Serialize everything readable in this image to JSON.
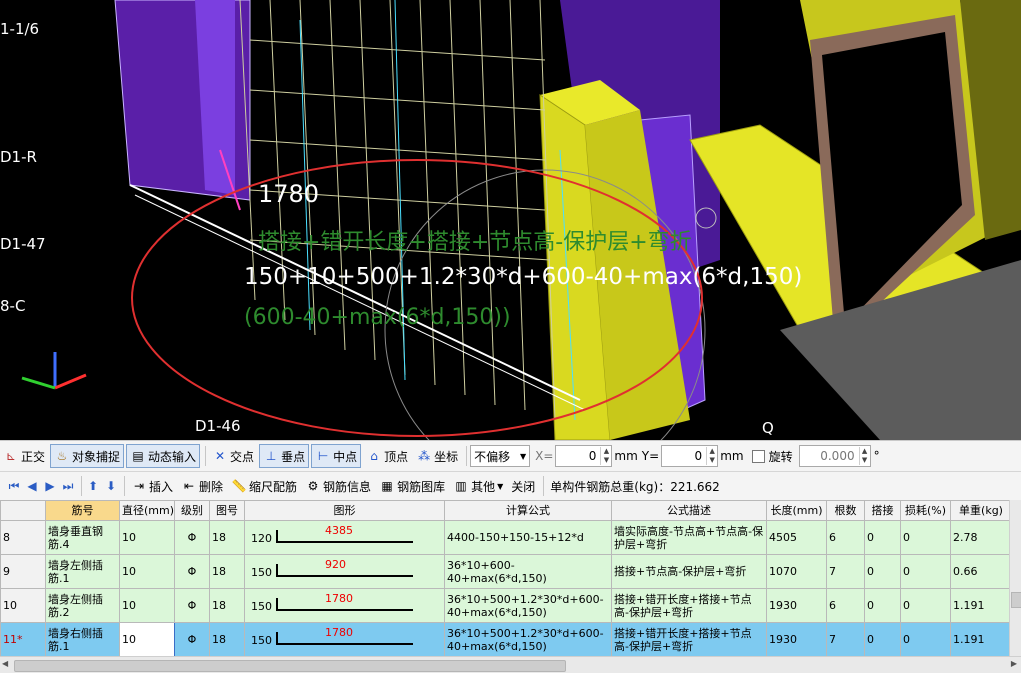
{
  "viewport": {
    "axis_labels": [
      "1-1/6",
      "D1-R",
      "D1-47",
      "8-C",
      "D1-46",
      "Q"
    ],
    "overlay_length": "1780",
    "overlay_formula_desc": "搭接+错开长度+搭接+节点高-保护层+弯折",
    "overlay_formula_line1": "150+10+500+1.2*30*d+600-40+max(6*d,150)",
    "overlay_formula_line2": "(600-40+max(6*d,150))",
    "highlight_color": "#e03030",
    "formula_color": "#2e8b2e"
  },
  "toolbar1": {
    "ortho": "正交",
    "snap": "对象捕捉",
    "dynamic_input": "动态输入",
    "intersection": "交点",
    "perpendicular": "垂点",
    "midpoint": "中点",
    "vertex": "顶点",
    "coordinate": "坐标",
    "offset_select": "不偏移",
    "x_label": "X=",
    "x_value": "0",
    "x_unit": "mm",
    "y_label": "Y=",
    "y_value": "0",
    "y_unit": "mm",
    "rotate_label": "旋转",
    "rotate_value": "0.000",
    "degree": "°"
  },
  "toolbar2": {
    "insert": "插入",
    "delete": "删除",
    "scale_rebar": "缩尺配筋",
    "rebar_info": "钢筋信息",
    "rebar_library": "钢筋图库",
    "other": "其他",
    "close": "关闭",
    "total_weight": "单构件钢筋总重(kg)：221.662"
  },
  "table": {
    "columns": [
      "筋号",
      "直径(mm)",
      "级别",
      "图号",
      "图形",
      "计算公式",
      "公式描述",
      "长度(mm)",
      "根数",
      "搭接",
      "损耗(%)",
      "单重(kg)"
    ],
    "rows": [
      {
        "row_no": "8",
        "name": "墙身垂直钢筋.4",
        "diameter": "10",
        "grade": "Φ",
        "fig_no": "18",
        "shape_lead": "120",
        "shape_len": "4385",
        "formula": "4400-150+150-15+12*d",
        "desc": "墙实际高度-节点高+节点高-保护层+弯折",
        "length": "4505",
        "count": "6",
        "lap": "0",
        "loss": "0",
        "unit_weight": "2.78"
      },
      {
        "row_no": "9",
        "name": "墙身左侧插筋.1",
        "diameter": "10",
        "grade": "Φ",
        "fig_no": "18",
        "shape_lead": "150",
        "shape_len": "920",
        "formula": "36*10+600-40+max(6*d,150)",
        "desc": "搭接+节点高-保护层+弯折",
        "length": "1070",
        "count": "7",
        "lap": "0",
        "loss": "0",
        "unit_weight": "0.66"
      },
      {
        "row_no": "10",
        "name": "墙身左侧插筋.2",
        "diameter": "10",
        "grade": "Φ",
        "fig_no": "18",
        "shape_lead": "150",
        "shape_len": "1780",
        "formula": "36*10+500+1.2*30*d+600-40+max(6*d,150)",
        "desc": "搭接+错开长度+搭接+节点高-保护层+弯折",
        "length": "1930",
        "count": "6",
        "lap": "0",
        "loss": "0",
        "unit_weight": "1.191"
      },
      {
        "row_no": "11*",
        "name": "墙身右侧插筋.1",
        "diameter": "10",
        "grade": "Φ",
        "fig_no": "18",
        "shape_lead": "150",
        "shape_len": "1780",
        "formula": "36*10+500+1.2*30*d+600-40+max(6*d,150)",
        "desc": "搭接+错开长度+搭接+节点高-保护层+弯折",
        "length": "1930",
        "count": "7",
        "lap": "0",
        "loss": "0",
        "unit_weight": "1.191"
      }
    ]
  }
}
